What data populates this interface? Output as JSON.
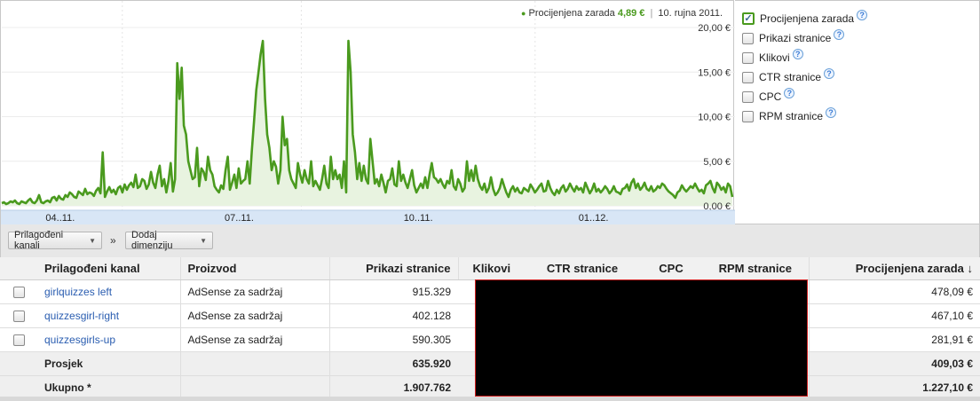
{
  "tooltip": {
    "label": "Procijenjena zarada",
    "value": "4,89 €",
    "date": "10. rujna 2011."
  },
  "chart_data": {
    "type": "area",
    "series": [
      {
        "name": "Procijenjena zarada",
        "color": "#4a9a1e",
        "values": [
          0.3,
          0.4,
          0.2,
          0.3,
          0.5,
          0.4,
          0.6,
          0.3,
          0.2,
          0.5,
          0.4,
          0.3,
          0.6,
          0.8,
          0.4,
          0.3,
          0.6,
          1.2,
          0.4,
          0.3,
          0.5,
          0.6,
          0.4,
          0.9,
          1.0,
          0.6,
          1.1,
          0.8,
          0.7,
          1.2,
          1.0,
          1.5,
          1.3,
          1.0,
          0.9,
          1.6,
          1.4,
          1.2,
          1.9,
          1.3,
          1.5,
          1.4,
          1.1,
          1.7,
          2.0,
          1.4,
          6.0,
          1.0,
          1.6,
          2.1,
          1.5,
          1.8,
          1.3,
          2.0,
          2.2,
          1.5,
          2.4,
          1.8,
          2.3,
          2.6,
          2.1,
          3.5,
          2.0,
          2.2,
          3.0,
          2.8,
          1.9,
          2.4,
          3.8,
          2.6,
          2.0,
          3.5,
          4.5,
          2.2,
          3.0,
          1.5,
          2.8,
          4.8,
          1.6,
          3.0,
          16.0,
          12.0,
          15.5,
          9.0,
          8.0,
          5.0,
          4.0,
          3.0,
          3.2,
          6.5,
          2.2,
          4.2,
          3.8,
          2.9,
          5.5,
          4.0,
          3.5,
          2.2,
          1.8,
          1.5,
          2.3,
          1.9,
          4.0,
          5.5,
          1.8,
          2.6,
          3.5,
          2.0,
          4.2,
          2.5,
          2.8,
          3.0,
          5.0,
          2.5,
          6.2,
          9.5,
          13.0,
          15.0,
          17.0,
          18.5,
          12.0,
          8.0,
          6.5,
          4.0,
          5.0,
          4.4,
          2.5,
          4.0,
          10.0,
          6.8,
          7.5,
          4.0,
          3.0,
          2.5,
          2.0,
          4.8,
          3.5,
          2.6,
          4.0,
          3.0,
          2.5,
          5.0,
          2.2,
          2.8,
          2.3,
          1.8,
          3.0,
          4.5,
          2.5,
          2.0,
          5.5,
          3.0,
          4.0,
          3.0,
          3.5,
          2.0,
          5.0,
          1.5,
          18.5,
          15.0,
          8.0,
          6.0,
          3.0,
          4.8,
          2.8,
          4.5,
          3.0,
          2.5,
          7.5,
          5.0,
          2.5,
          3.0,
          2.2,
          3.5,
          2.6,
          1.5,
          2.8,
          3.0,
          4.2,
          2.4,
          2.2,
          5.0,
          2.8,
          3.5,
          2.6,
          2.0,
          3.0,
          4.0,
          2.3,
          1.5,
          2.0,
          2.5,
          2.0,
          3.2,
          2.0,
          3.5,
          4.8,
          3.2,
          3.0,
          2.6,
          3.0,
          2.4,
          2.0,
          2.8,
          2.5,
          4.0,
          2.2,
          1.8,
          3.0,
          2.5,
          1.6,
          2.0,
          5.0,
          2.8,
          4.0,
          2.8,
          4.5,
          3.0,
          2.2,
          1.8,
          2.5,
          1.5,
          2.0,
          3.2,
          1.9,
          1.2,
          1.5,
          2.0,
          3.0,
          2.2,
          1.5,
          1.0,
          1.8,
          2.2,
          1.6,
          2.0,
          1.5,
          1.4,
          2.0,
          1.8,
          1.6,
          2.4,
          2.0,
          1.5,
          1.8,
          2.2,
          2.5,
          1.6,
          1.7,
          2.8,
          2.0,
          1.5,
          1.2,
          1.8,
          1.4,
          2.0,
          2.3,
          1.6,
          1.9,
          2.5,
          2.0,
          1.6,
          2.2,
          1.8,
          2.0,
          1.5,
          2.6,
          2.0,
          1.4,
          1.8,
          2.5,
          1.6,
          1.9,
          1.5,
          1.8,
          2.2,
          1.9,
          1.4,
          1.7,
          2.2,
          1.6,
          1.5,
          1.3,
          1.9,
          2.0,
          2.4,
          1.7,
          2.6,
          3.0,
          2.0,
          2.5,
          1.8,
          2.1,
          2.6,
          1.9,
          1.7,
          2.2,
          1.6,
          1.8,
          2.2,
          2.0,
          2.5,
          2.3,
          1.9,
          1.6,
          1.4,
          1.2,
          0.9,
          1.5,
          1.7,
          2.3,
          1.9,
          1.6,
          1.9,
          2.2,
          2.0,
          2.5,
          2.0,
          1.6,
          1.8,
          1.4,
          2.3,
          2.5,
          2.8,
          2.0,
          1.5,
          2.6,
          2.3,
          1.8,
          2.1,
          1.5,
          2.5,
          2.2,
          1.0
        ]
      }
    ],
    "y_ticks": [
      "20,00 €",
      "15,00 €",
      "10,00 €",
      "5,00 €",
      "0,00 €"
    ],
    "ylim": [
      0,
      21
    ],
    "x_ticks": [
      "04..11.",
      "07..11.",
      "10..11.",
      "01..12."
    ],
    "grid": true
  },
  "metrics": [
    {
      "label": "Procijenjena zarada",
      "checked": true
    },
    {
      "label": "Prikazi stranice",
      "checked": false
    },
    {
      "label": "Klikovi",
      "checked": false
    },
    {
      "label": "CTR stranice",
      "checked": false
    },
    {
      "label": "CPC",
      "checked": false
    },
    {
      "label": "RPM stranice",
      "checked": false
    }
  ],
  "help_glyph": "?",
  "toolbar": {
    "channels": "Prilagođeni kanali",
    "separator": "»",
    "dimensions": "Dodaj dimenziju",
    "caret": "▼"
  },
  "table": {
    "headers": [
      "Prilagođeni kanal",
      "Proizvod",
      "Prikazi stranice",
      "Klikovi",
      "CTR stranice",
      "CPC",
      "RPM stranice",
      "Procijenjena zarada"
    ],
    "sort_arrow": "↓",
    "rows": [
      {
        "channel": "girlquizzes left",
        "product": "AdSense za sadržaj",
        "views": "915.329",
        "earnings": "478,09 €"
      },
      {
        "channel": "quizzesgirl-right",
        "product": "AdSense za sadržaj",
        "views": "402.128",
        "earnings": "467,10 €"
      },
      {
        "channel": "quizzesgirls-up",
        "product": "AdSense za sadržaj",
        "views": "590.305",
        "earnings": "281,91 €"
      }
    ],
    "average": {
      "label": "Prosjek",
      "views": "635.920",
      "earnings": "409,03 €"
    },
    "total": {
      "label": "Ukupno *",
      "views": "1.907.762",
      "earnings": "1.227,10 €"
    }
  }
}
